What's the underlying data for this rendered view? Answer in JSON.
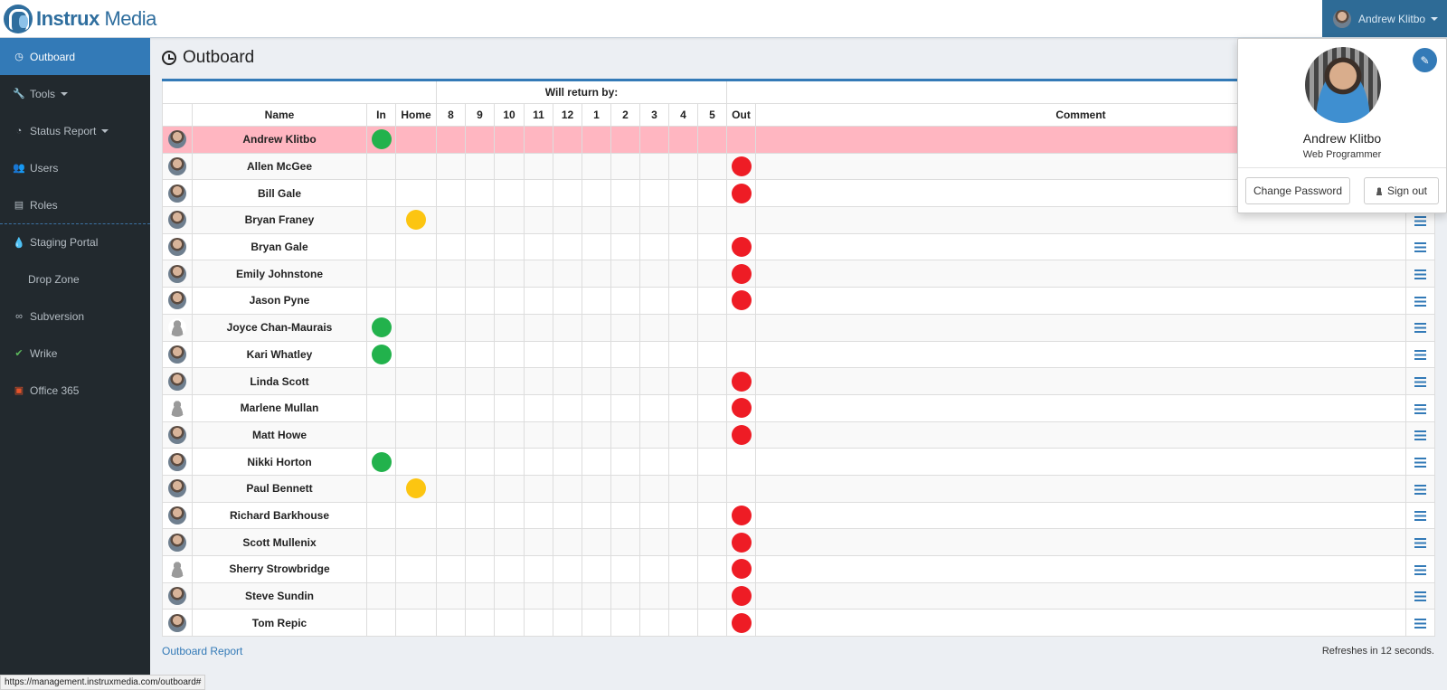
{
  "brand": {
    "name_bold": "Instrux",
    "name_rest": " Media"
  },
  "user": {
    "name": "Andrew Klitbo",
    "role": "Web Programmer"
  },
  "sidebar": {
    "items": [
      {
        "label": "Outboard",
        "icon": "clock-icon",
        "active": true
      },
      {
        "label": "Tools",
        "icon": "wrench-icon",
        "caret": true
      },
      {
        "label": "Status Report",
        "icon": "pie-chart-icon",
        "caret": true
      },
      {
        "label": "Users",
        "icon": "users-icon"
      },
      {
        "label": "Roles",
        "icon": "id-card-icon"
      },
      {
        "label": "Staging Portal",
        "icon": "drop-icon"
      },
      {
        "label": "Drop Zone",
        "icon": ""
      },
      {
        "label": "Subversion",
        "icon": "link-icon"
      },
      {
        "label": "Wrike",
        "icon": "check-icon"
      },
      {
        "label": "Office 365",
        "icon": "office-icon"
      }
    ]
  },
  "page": {
    "title": "Outboard",
    "group_header": "Will return by:",
    "columns": {
      "name": "Name",
      "in": "In",
      "home": "Home",
      "out": "Out",
      "comment": "Comment"
    },
    "hours": [
      "8",
      "9",
      "10",
      "11",
      "12",
      "1",
      "2",
      "3",
      "4",
      "5"
    ],
    "report_link": "Outboard Report",
    "refresh_text": "Refreshes in 12 seconds."
  },
  "status_colors": {
    "in": "#22b24c",
    "home": "#fcc511",
    "out": "#ee1c25"
  },
  "rows": [
    {
      "name": "Andrew Klitbo",
      "status": "in",
      "me": true
    },
    {
      "name": "Allen McGee",
      "status": "out"
    },
    {
      "name": "Bill Gale",
      "status": "out"
    },
    {
      "name": "Bryan Franey",
      "status": "home"
    },
    {
      "name": "Bryan Gale",
      "status": "out"
    },
    {
      "name": "Emily Johnstone",
      "status": "out"
    },
    {
      "name": "Jason Pyne",
      "status": "out"
    },
    {
      "name": "Joyce Chan-Maurais",
      "status": "in",
      "blank": true
    },
    {
      "name": "Kari Whatley",
      "status": "in"
    },
    {
      "name": "Linda Scott",
      "status": "out"
    },
    {
      "name": "Marlene Mullan",
      "status": "out",
      "blank": true
    },
    {
      "name": "Matt Howe",
      "status": "out"
    },
    {
      "name": "Nikki Horton",
      "status": "in"
    },
    {
      "name": "Paul Bennett",
      "status": "home"
    },
    {
      "name": "Richard Barkhouse",
      "status": "out"
    },
    {
      "name": "Scott Mullenix",
      "status": "out"
    },
    {
      "name": "Sherry Strowbridge",
      "status": "out",
      "blank": true
    },
    {
      "name": "Steve Sundin",
      "status": "out"
    },
    {
      "name": "Tom Repic",
      "status": "out"
    }
  ],
  "dropdown": {
    "change_password": "Change Password",
    "sign_out": "Sign out"
  },
  "statusbar": {
    "url": "https://management.instruxmedia.com/outboard#"
  }
}
